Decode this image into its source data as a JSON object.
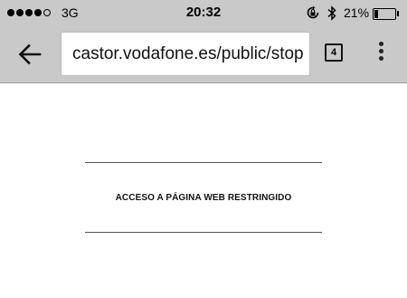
{
  "status_bar": {
    "signal_dots": [
      true,
      true,
      true,
      true,
      false
    ],
    "carrier": "3G",
    "time": "20:32",
    "battery_percent_label": "21%",
    "battery_level": 0.21,
    "icons": [
      "orientation-lock-icon",
      "bluetooth-icon",
      "battery-icon"
    ]
  },
  "toolbar": {
    "url": "castor.vodafone.es/public/stop",
    "tab_count": "4",
    "icons": [
      "back-arrow-icon",
      "tabs-icon",
      "overflow-menu-icon"
    ]
  },
  "page": {
    "message": "ACCESO A PÁGINA WEB RESTRINGIDO"
  }
}
